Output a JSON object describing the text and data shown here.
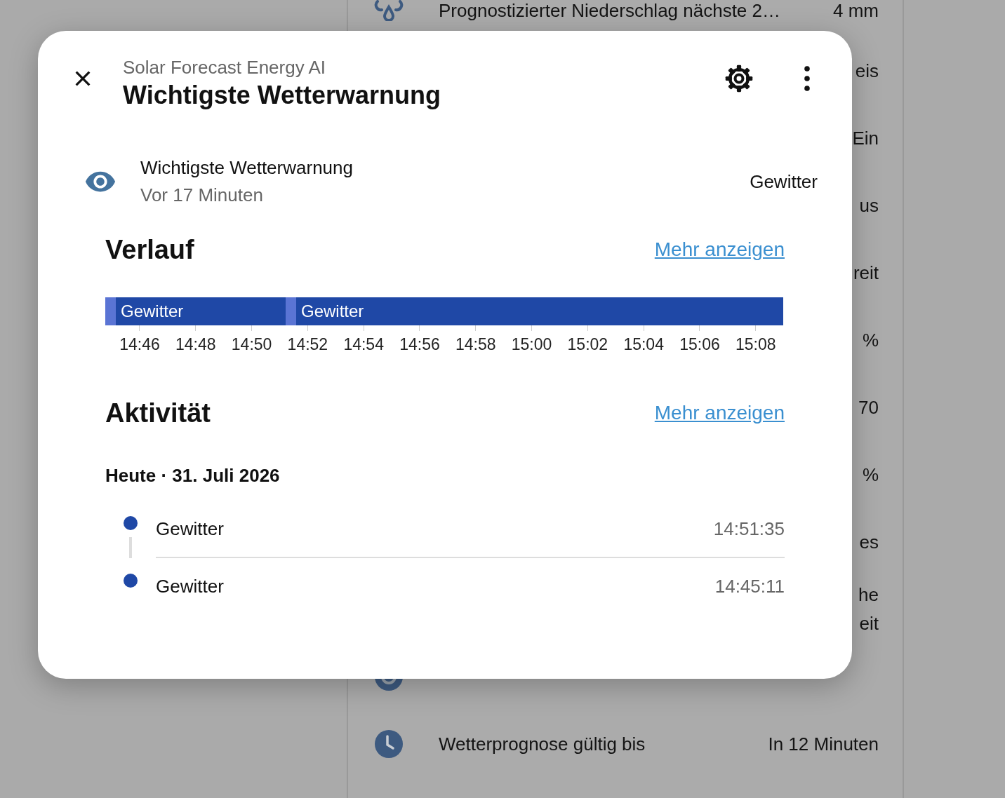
{
  "background_list": [
    {
      "kind": "drops",
      "name": "Prognostizierter Niederschlag nächste 2…",
      "value": "4 mm"
    },
    {
      "kind": "none",
      "value": "eis"
    },
    {
      "kind": "none",
      "value": "Ein"
    },
    {
      "kind": "none",
      "value": "us"
    },
    {
      "kind": "none",
      "value": "reit"
    },
    {
      "kind": "none",
      "value": "%"
    },
    {
      "kind": "none",
      "value": "70"
    },
    {
      "kind": "none",
      "value": "%"
    },
    {
      "kind": "none",
      "value": "es"
    },
    {
      "kind": "none",
      "value": "he\neit"
    },
    {
      "kind": "ring"
    },
    {
      "kind": "clock",
      "name": "Wetterprognose gültig bis",
      "value": "In 12 Minuten"
    }
  ],
  "dialog": {
    "subtitle": "Solar Forecast Energy AI",
    "title": "Wichtigste Wetterwarnung",
    "entity": {
      "name": "Wichtigste Wetterwarnung",
      "last_changed": "Vor 17 Minuten",
      "state": "Gewitter"
    },
    "history": {
      "heading": "Verlauf",
      "link": "Mehr anzeigen",
      "segments": [
        {
          "label": "Gewitter"
        },
        {
          "label": "Gewitter"
        }
      ],
      "ticks": [
        "14:46",
        "14:48",
        "14:50",
        "14:52",
        "14:54",
        "14:56",
        "14:58",
        "15:00",
        "15:02",
        "15:04",
        "15:06",
        "15:08"
      ]
    },
    "activity": {
      "heading": "Aktivität",
      "link": "Mehr anzeigen",
      "date": "Heute · 31. Juli 2026",
      "entries": [
        {
          "label": "Gewitter",
          "time": "14:51:35"
        },
        {
          "label": "Gewitter",
          "time": "14:45:11"
        }
      ]
    }
  }
}
